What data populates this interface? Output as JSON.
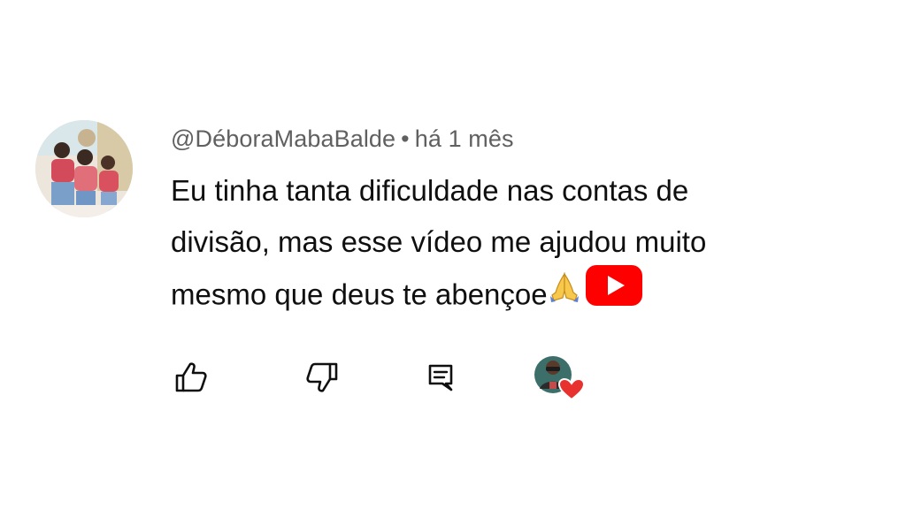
{
  "comment": {
    "author": "@DéboraMabaBalde",
    "separator": "•",
    "time": "há 1 mês",
    "text_lines": [
      "Eu tinha tanta dificuldade nas contas de",
      "divisão, mas esse vídeo me ajudou muito",
      "mesmo que deus te abençoe"
    ],
    "emojis": [
      "folded-hands",
      "youtube-logo"
    ]
  },
  "actions": {
    "icons": [
      "thumbs-up-icon",
      "thumbs-down-icon",
      "reply-icon",
      "creator-heart-icon"
    ]
  },
  "colors": {
    "meta_text": "#606060",
    "body_text": "#0f0f0f",
    "youtube_red": "#ff0000",
    "heart_red": "#e8322f"
  }
}
